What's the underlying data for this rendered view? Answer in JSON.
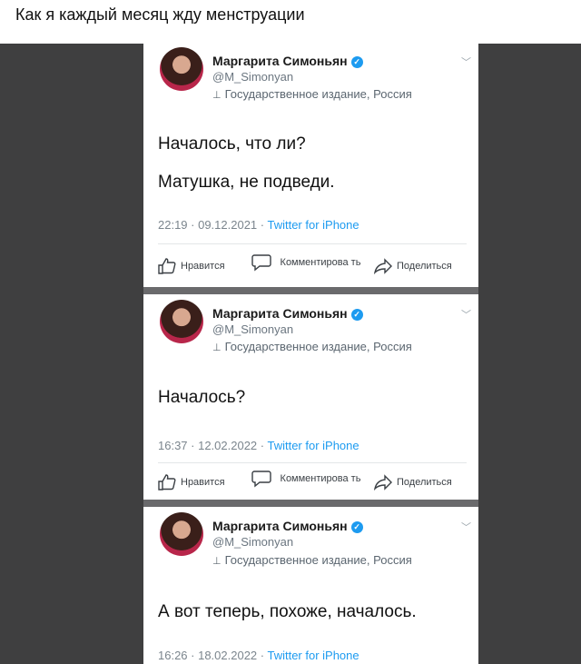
{
  "caption": "Как я каждый месяц жду менструации",
  "author": {
    "name": "Маргарита Симоньян",
    "handle": "@M_Simonyan",
    "label": "Государственное издание, Россия"
  },
  "actions": {
    "like": "Нравится",
    "comment": "Комментирова ть",
    "share": "Поделиться"
  },
  "tweets": [
    {
      "lines": [
        "Началось, что ли?",
        "Матушка, не подведи."
      ],
      "time": "22:19 · 09.12.2021 · ",
      "source": "Twitter for iPhone"
    },
    {
      "lines": [
        "Началось?"
      ],
      "time": "16:37 · 12.02.2022 · ",
      "source": "Twitter for iPhone"
    },
    {
      "lines": [
        "А вот теперь, похоже, началось."
      ],
      "time": "16:26 · 18.02.2022 · ",
      "source": "Twitter for iPhone"
    }
  ]
}
